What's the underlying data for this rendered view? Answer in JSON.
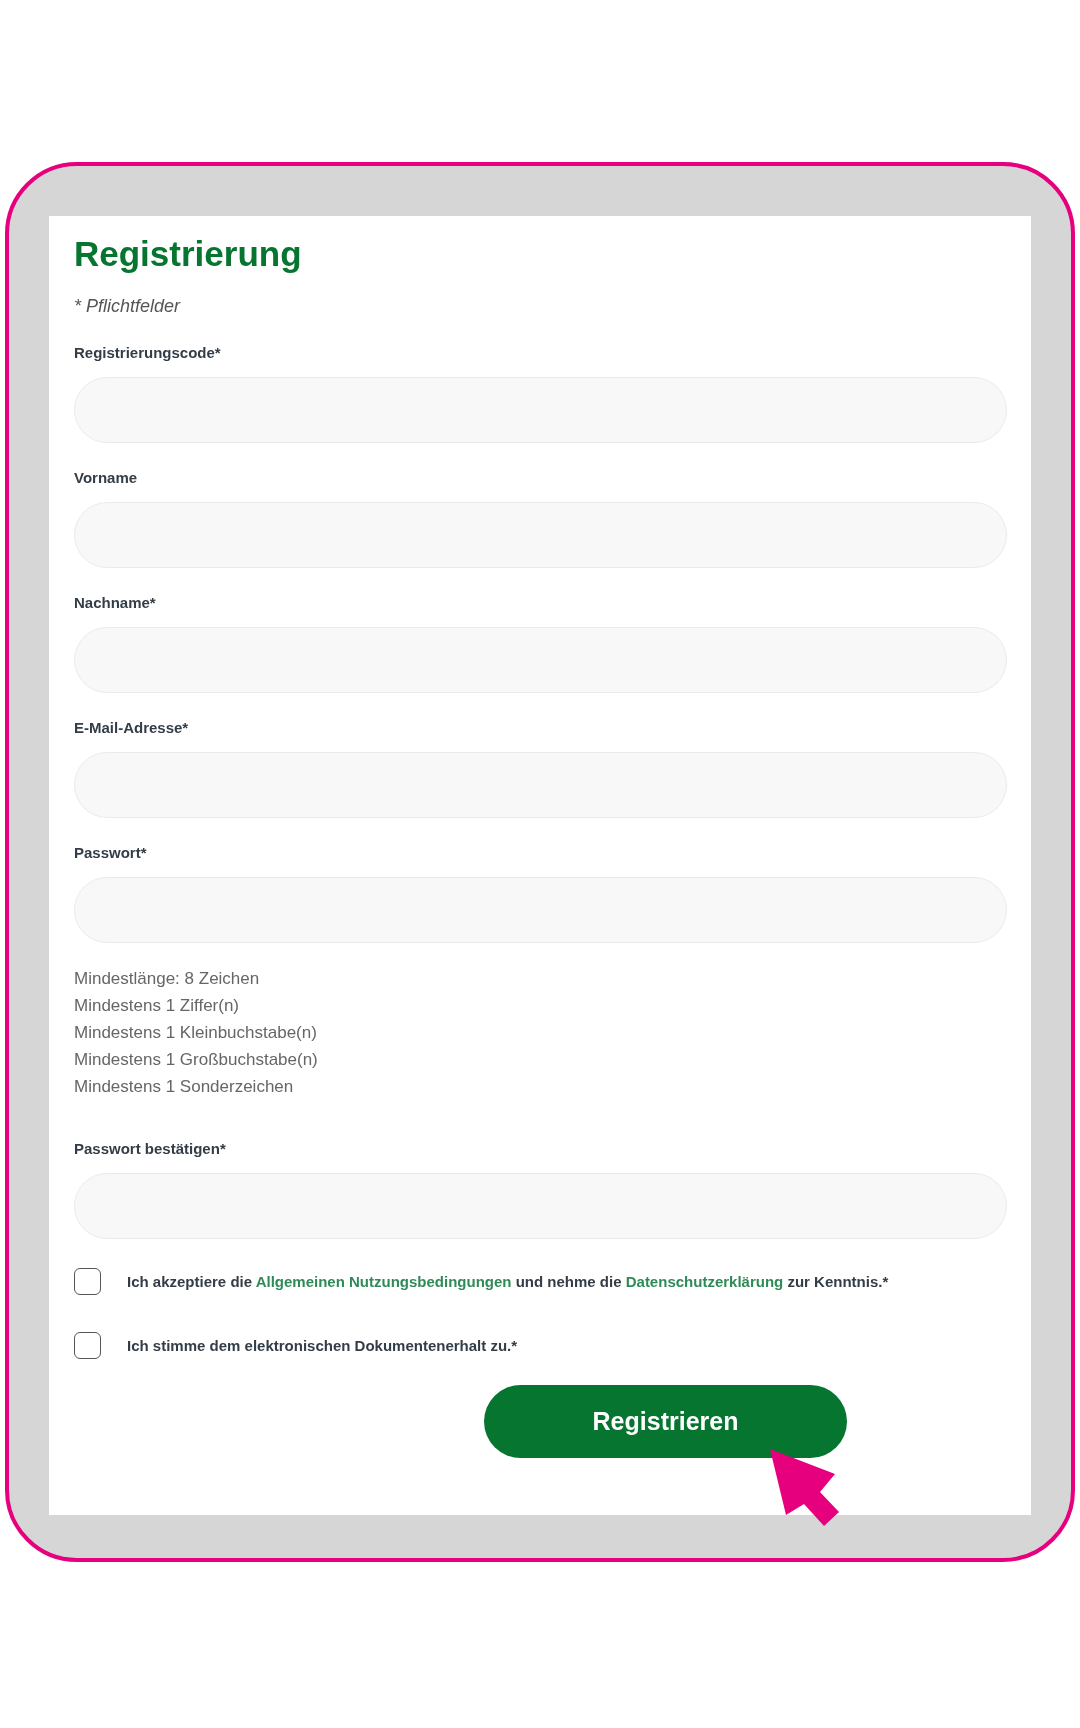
{
  "form": {
    "title": "Registrierung",
    "required_note": "* Pflichtfelder"
  },
  "fields": [
    {
      "label": "Registrierungscode*"
    },
    {
      "label": "Vorname"
    },
    {
      "label": "Nachname*"
    },
    {
      "label": "E-Mail-Adresse*"
    },
    {
      "label": "Passwort*",
      "requirements": [
        "Mindestlänge: 8 Zeichen",
        "Mindestens 1 Ziffer(n)",
        "Mindestens 1 Kleinbuchstabe(n)",
        "Mindestens 1 Großbuchstabe(n)",
        "Mindestens 1 Sonderzeichen"
      ]
    },
    {
      "label": "Passwort bestätigen*"
    }
  ],
  "checkboxes": [
    {
      "checked": false,
      "segments": [
        {
          "kind": "text",
          "text": "Ich akzeptiere die"
        },
        {
          "kind": "link",
          "text": "Allgemeinen Nutzungsbedingungen"
        },
        {
          "kind": "text",
          "text": "und nehme die"
        },
        {
          "kind": "link",
          "text": "Datenschutzerklärung"
        },
        {
          "kind": "text",
          "text": "zur Kenntnis.*"
        }
      ]
    },
    {
      "checked": false,
      "segments": [
        {
          "kind": "text",
          "text": "Ich stimme dem elektronischen Dokumentenerhalt zu.*"
        }
      ]
    }
  ],
  "submit_button": {
    "label": "Registrieren"
  }
}
